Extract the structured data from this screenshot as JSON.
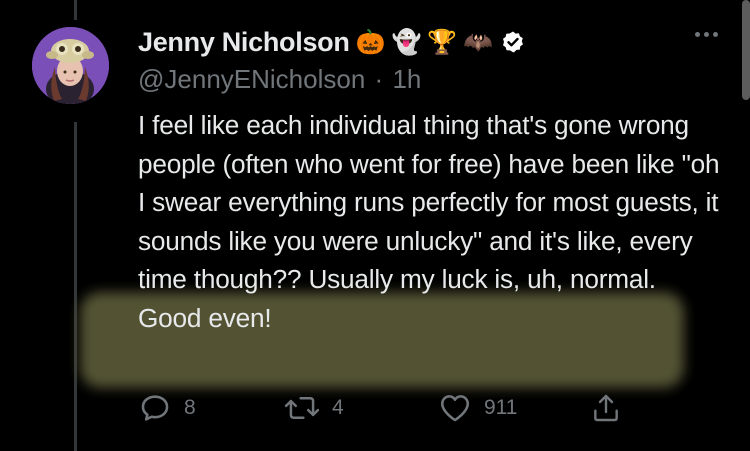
{
  "user": {
    "display_name": "Jenny Nicholson",
    "badges": [
      "🎃",
      "👻",
      "🏆",
      "🦇"
    ],
    "verified_icon": "verified-badge-icon",
    "handle": "@JennyENicholson",
    "separator": "·",
    "time": "1h"
  },
  "tweet": {
    "text": "I feel like each individual thing that's gone wrong people (often who went for free) have been like \"oh I swear everything runs perfectly for most guests, it sounds like you were unlucky\" and it's like, every time though?? Usually my luck is, uh, normal. Good even!"
  },
  "actions": {
    "reply": {
      "icon": "reply-icon",
      "count": "8"
    },
    "retweet": {
      "icon": "retweet-icon",
      "count": "4"
    },
    "like": {
      "icon": "heart-icon",
      "count": "911"
    },
    "share": {
      "icon": "share-icon"
    }
  },
  "colors": {
    "background": "#000000",
    "text": "#e7e9ea",
    "secondary": "#71767b",
    "highlight": "#5c5c3a"
  }
}
